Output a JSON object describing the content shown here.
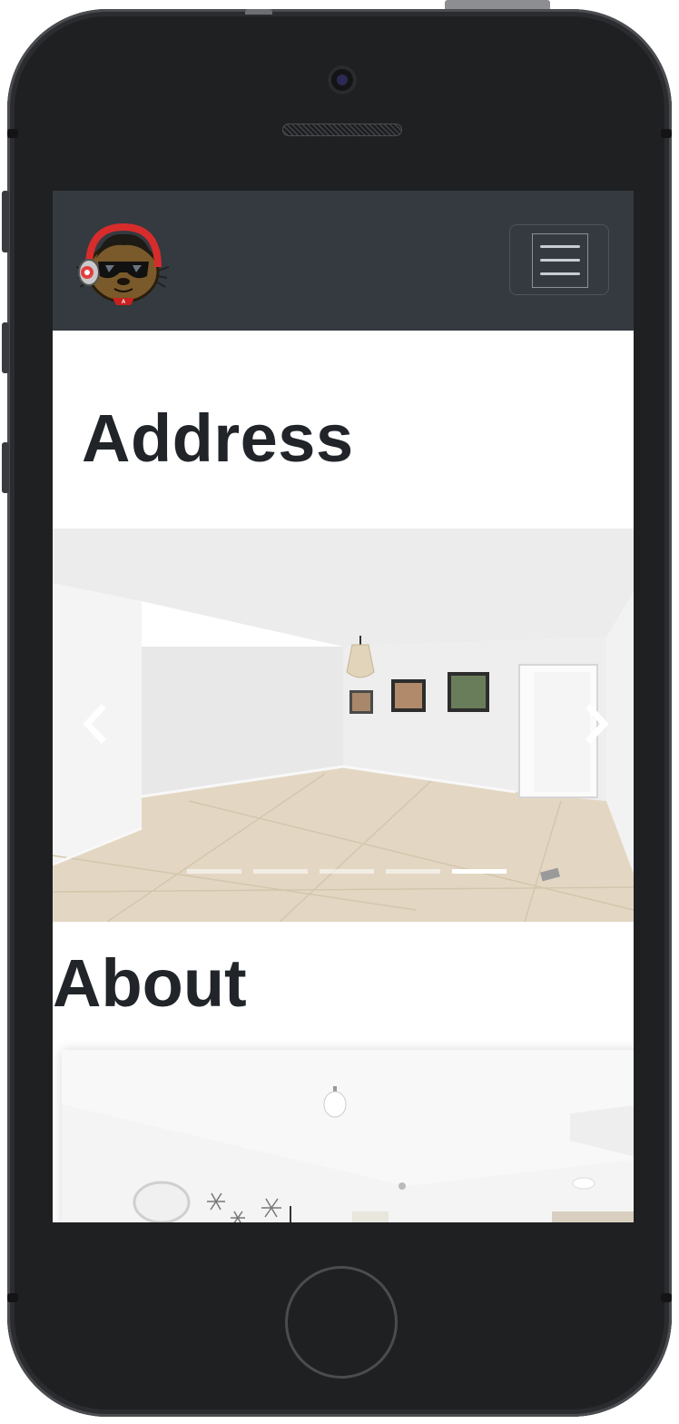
{
  "navbar": {
    "logo_icon": "mascot-logo-icon",
    "toggle_icon": "hamburger-menu-icon",
    "bg_color": "#343a40"
  },
  "main": {
    "address_heading": "Address",
    "about_heading": "About"
  },
  "carousel": {
    "prev_icon": "chevron-left-icon",
    "next_icon": "chevron-right-icon",
    "slide_count": 5,
    "active_index": 4
  },
  "device": {
    "frame_color": "#1f2022"
  }
}
